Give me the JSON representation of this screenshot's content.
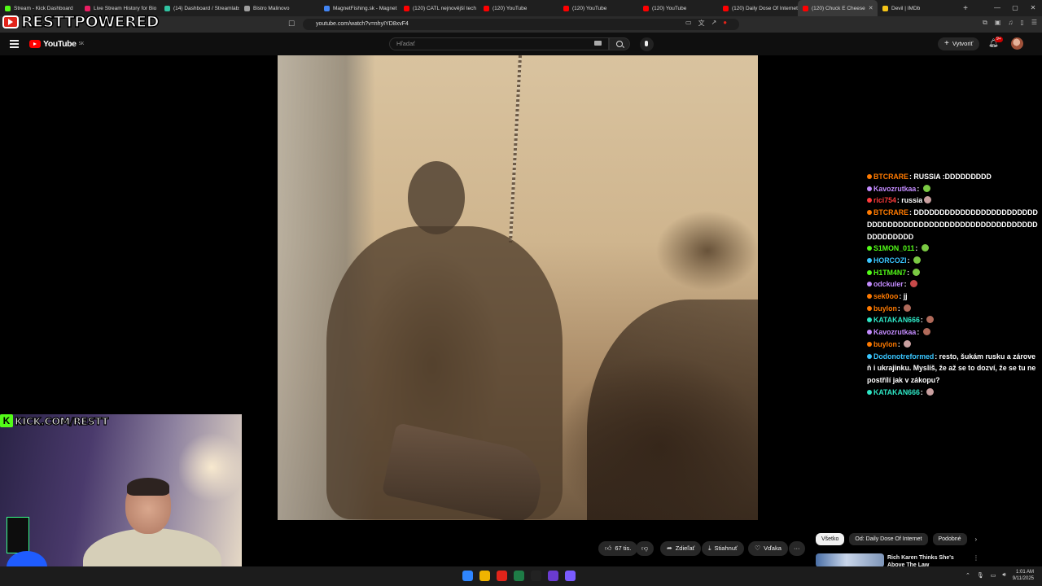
{
  "browser": {
    "tabs": [
      {
        "label": "Stream - Kick Dashboard",
        "color": "#53fc18"
      },
      {
        "label": "Live Stream History for Bio",
        "color": "#e91e63"
      },
      {
        "label": "(14) Dashboard / Streamlabs",
        "color": "#31c3a2"
      },
      {
        "label": "Bistro Malinovo",
        "color": "#9e9e9e"
      },
      {
        "label": "MagnetFishing.sk - Magnet",
        "color": "#4285f4"
      },
      {
        "label": "(120) CATL nejnovější tech",
        "color": "#ff0000"
      },
      {
        "label": "(120) YouTube",
        "color": "#ff0000"
      },
      {
        "label": "(120) YouTube",
        "color": "#ff0000"
      },
      {
        "label": "(120) YouTube",
        "color": "#ff0000"
      },
      {
        "label": "(120) Daily Dose Of Internet",
        "color": "#ff0000"
      },
      {
        "label": "(120) Chuck E Cheese",
        "color": "#ff0000"
      },
      {
        "label": "Devil | IMDb",
        "color": "#f5c518"
      }
    ],
    "active_tab": 10,
    "url": "youtube.com/watch?v=nhyIYD8xvF4"
  },
  "overlay": {
    "logo_text": "RESTTPOWERED",
    "kick_k": "K",
    "kick_text": "KICK.COM/RESTT"
  },
  "youtube": {
    "logo_word": "YouTube",
    "logo_sup": "SK",
    "search_placeholder": "Hľadať",
    "create_label": "Vytvoriť",
    "notif_count": "9+"
  },
  "actions": {
    "likes": "67 tis.",
    "share": "Zdieľať",
    "download": "Stiahnuť",
    "thanks": "Vďaka",
    "more": "···"
  },
  "chips": {
    "all": "Všetko",
    "from": "Od: Daily Dose Of Internet",
    "similar": "Podobné"
  },
  "recommendation": {
    "title": "Rich Karen Thinks She's Above The Law"
  },
  "chat": [
    {
      "user": "BTCRARE",
      "text": "RUSSIA :DDDDDDDDD",
      "color": "#ff7a00",
      "emote": ""
    },
    {
      "user": "Kavozrutkaa",
      "text": "",
      "color": "#c48cff",
      "emote": "#7ac943"
    },
    {
      "user": "rici754",
      "text": "russia",
      "color": "#ff3b3b",
      "emote": "#c9a0a0"
    },
    {
      "user": "BTCRARE",
      "text": "DDDDDDDDDDDDDDDDDDDDDDDDDDDDDDDDDDDDDDDDDDDDDDDDDDDDDDDDDDDDDDDDDD",
      "color": "#ff7a00",
      "emote": ""
    },
    {
      "user": "S1MON_011",
      "text": "",
      "color": "#53fc18",
      "emote": "#7ac943"
    },
    {
      "user": "HORCOZI",
      "text": "",
      "color": "#39c6ff",
      "emote": "#7ac943"
    },
    {
      "user": "H1TM4N7",
      "text": "",
      "color": "#53fc18",
      "emote": "#7ac943"
    },
    {
      "user": "odckuler",
      "text": "",
      "color": "#c48cff",
      "emote": "#c94a4a"
    },
    {
      "user": "sek0oo",
      "text": "jj",
      "color": "#ff7a00",
      "emote": ""
    },
    {
      "user": "buylon",
      "text": "",
      "color": "#ff7a00",
      "emote": "#b06a5a"
    },
    {
      "user": "KATAKAN666",
      "text": "",
      "color": "#2ee6c5",
      "emote": "#b06a5a"
    },
    {
      "user": "Kavozrutkaa",
      "text": "",
      "color": "#c48cff",
      "emote": "#b06a5a"
    },
    {
      "user": "buylon",
      "text": "",
      "color": "#ff7a00",
      "emote": "#c9a0a0"
    },
    {
      "user": "Dodonotreformed",
      "text": "resto, šukám rusku a zároveň i ukrajinku. Myslíš, že až se to dozví, že se tu nepostřílí jak v zákopu?",
      "color": "#39c6ff",
      "emote": ""
    },
    {
      "user": "KATAKAN666",
      "text": "",
      "color": "#2ee6c5",
      "emote": "#c9a0a0"
    }
  ],
  "taskbar": {
    "time": "1:01 AM",
    "date": "9/11/2025",
    "apps": [
      "#2f86ff",
      "#f0b400",
      "#e0241a",
      "#1e7c46",
      "#222222",
      "#6a3bd1",
      "#7a5bff"
    ]
  }
}
